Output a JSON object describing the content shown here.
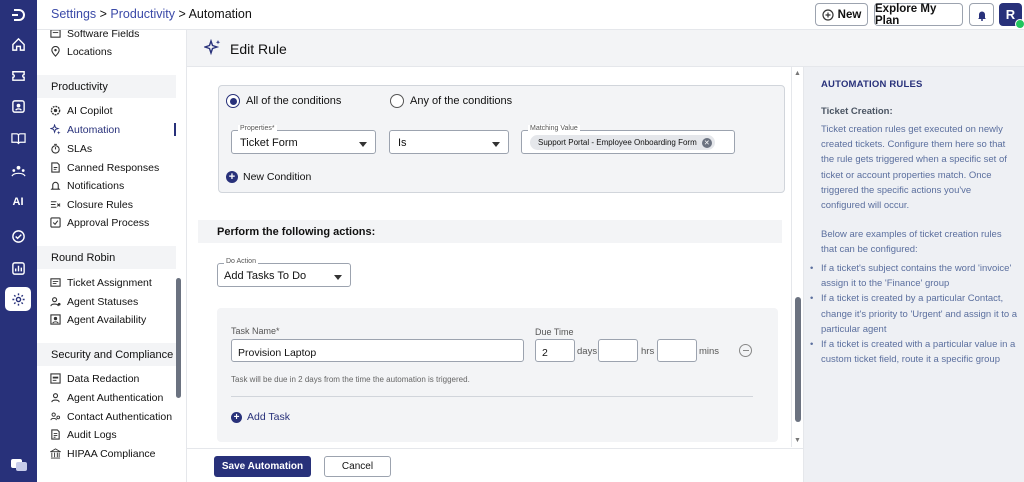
{
  "breadcrumb": {
    "settings": "Settings",
    "sep1": " > ",
    "productivity": "Productivity",
    "sep2": " > ",
    "current": "Automation"
  },
  "topbar": {
    "new_label": "New",
    "explore_label": "Explore My Plan",
    "avatar_initial": "R"
  },
  "rail": {
    "ai_label": "AI"
  },
  "sidebar": {
    "top_items": [
      "Software Fields",
      "Locations"
    ],
    "productivity": {
      "title": "Productivity",
      "items": [
        "AI Copilot",
        "Automation",
        "SLAs",
        "Canned Responses",
        "Notifications",
        "Closure Rules",
        "Approval Process"
      ]
    },
    "round_robin": {
      "title": "Round Robin",
      "items": [
        "Ticket Assignment",
        "Agent Statuses",
        "Agent Availability"
      ]
    },
    "security": {
      "title": "Security and Compliance",
      "items": [
        "Data Redaction",
        "Agent Authentication",
        "Contact Authentication",
        "Audit Logs",
        "HIPAA Compliance"
      ]
    }
  },
  "header": {
    "title": "Edit Rule"
  },
  "conditions": {
    "all_label": "All of the conditions",
    "any_label": "Any of the conditions",
    "selected": "all",
    "properties_label": "Properties*",
    "properties_value": "Ticket Form",
    "operator_value": "Is",
    "matching_label": "Matching Value",
    "matching_chip": "Support Portal - Employee Onboarding Form",
    "new_condition": "New Condition"
  },
  "actions": {
    "section_title": "Perform the following actions:",
    "do_action_label": "Do Action",
    "do_action_value": "Add Tasks To Do",
    "task_name_label": "Task Name",
    "task_name_required": "*",
    "task_name_value": "Provision Laptop",
    "due_time_label": "Due Time",
    "days_value": "2",
    "days_unit": "days",
    "hrs_unit": "hrs",
    "mins_unit": "mins",
    "hint": "Task will be due in 2 days from the time the automation is triggered.",
    "add_task": "Add Task"
  },
  "footer": {
    "save_label": "Save Automation",
    "cancel_label": "Cancel"
  },
  "help": {
    "title": "AUTOMATION RULES",
    "subtitle": "Ticket Creation:",
    "para1": "Ticket creation rules get executed on newly created tickets. Configure them here so that the rule gets triggered when a specific set of ticket or account properties match. Once triggered the specific actions you've configured will occur.",
    "para2": "Below are examples of ticket creation rules that can be configured:",
    "examples": [
      "If a ticket's subject contains the word 'invoice' assign it to the 'Finance' group",
      "If a ticket is created by a particular Contact, change it's priority to 'Urgent' and assign it to a particular agent",
      "If a ticket is created with a particular value in a custom ticket field, route it a specific group"
    ]
  },
  "colors": {
    "brand": "#28317a",
    "link": "#3b4aa8",
    "help_text": "#5b6f9e",
    "online": "#22c55e"
  }
}
